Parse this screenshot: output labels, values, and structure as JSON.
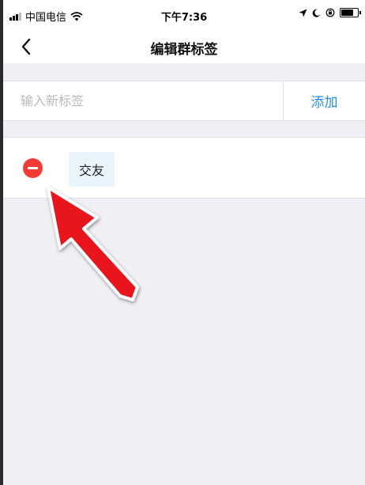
{
  "status_bar": {
    "carrier": "中国电信",
    "time": "下午7:36"
  },
  "nav": {
    "title": "编辑群标签",
    "back_icon": "chevron-left-icon"
  },
  "tag_input": {
    "placeholder": "输入新标签",
    "value": "",
    "add_label": "添加"
  },
  "tags": [
    {
      "label": "交友"
    }
  ],
  "colors": {
    "accent": "#2b8de3",
    "delete": "#f23b35",
    "chip_bg": "#e9f4fc",
    "page_bg": "#efeff4",
    "annotation_arrow": "#e8141b"
  }
}
